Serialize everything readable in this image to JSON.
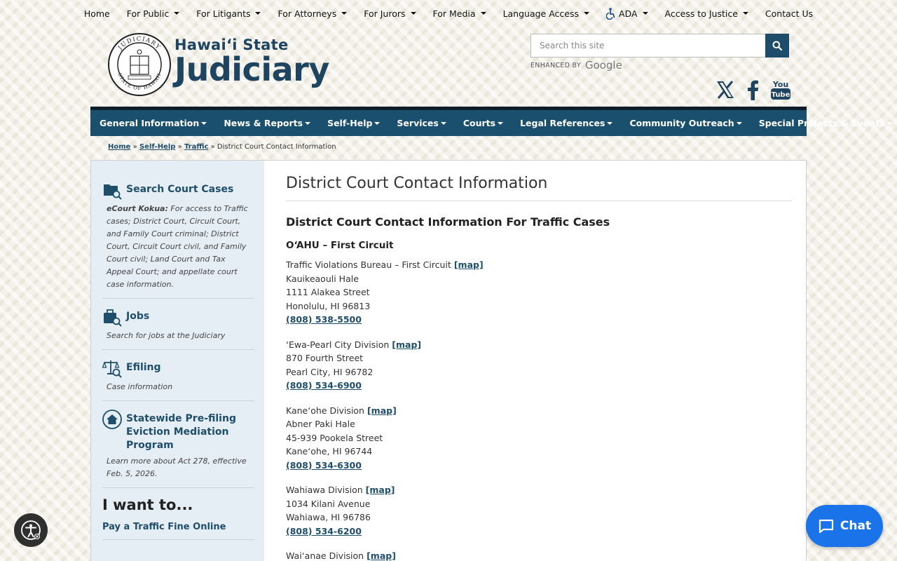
{
  "top_nav": [
    {
      "label": "Home",
      "dropdown": false
    },
    {
      "label": "For Public",
      "dropdown": true
    },
    {
      "label": "For Litigants",
      "dropdown": true
    },
    {
      "label": "For Attorneys",
      "dropdown": true
    },
    {
      "label": "For Jurors",
      "dropdown": true
    },
    {
      "label": "For Media",
      "dropdown": true
    },
    {
      "label": "Language Access",
      "dropdown": true
    },
    {
      "label": "ADA",
      "dropdown": true,
      "icon": "wheelchair-icon"
    },
    {
      "label": "Access to Justice",
      "dropdown": true
    },
    {
      "label": "Contact Us",
      "dropdown": false
    }
  ],
  "brand": {
    "line1": "Hawaiʻi State",
    "line2": "Judiciary",
    "seal_top": "JUDICIARY",
    "seal_bottom": "STATE OF HAWAII"
  },
  "search": {
    "placeholder": "Search this site",
    "enhanced_label": "ENHANCED BY",
    "provider": "Google"
  },
  "main_nav": [
    "General Information",
    "News & Reports",
    "Self-Help",
    "Services",
    "Courts",
    "Legal References",
    "Community Outreach",
    "Special Projects & Events"
  ],
  "breadcrumb": {
    "links": [
      "Home",
      "Self-Help",
      "Traffic"
    ],
    "current": "District Court Contact Information",
    "separator": "»"
  },
  "sidebar": {
    "items": [
      {
        "icon": "folder-search-icon",
        "label": "Search Court Cases",
        "desc_bold": "eCourt Kokua:",
        "desc": " For access to Traffic cases; District Court, Circuit Court, and Family Court criminal; District Court, Circuit Court civil, and Family Court civil; Land Court and Tax Appeal Court; and appellate court case information."
      },
      {
        "icon": "briefcase-search-icon",
        "label": "Jobs",
        "desc_bold": "",
        "desc": "Search for jobs at the Judiciary"
      },
      {
        "icon": "scales-search-icon",
        "label": "Efiling",
        "desc_bold": "",
        "desc": "Case information"
      },
      {
        "icon": "house-icon",
        "label": "Statewide Pre-filing Eviction Mediation Program",
        "desc_bold": "",
        "desc": "Learn more about Act 278, effective Feb. 5, 2026."
      }
    ],
    "iwant_title": "I want to...",
    "iwant_links": [
      "Pay a Traffic Fine Online"
    ]
  },
  "content": {
    "title": "District Court Contact Information",
    "subtitle": "District Court Contact Information For Traffic Cases",
    "circuit": "O‘AHU – First Circuit",
    "map_label": "[map]",
    "locations": [
      {
        "name": "Traffic Violations Bureau – First Circuit",
        "lines": [
          "Kauikeaouli Hale",
          "1111 Alakea Street",
          "Honolulu, HI 96813"
        ],
        "phone": "(808) 538-5500"
      },
      {
        "name": "ʻEwa-Pearl City Division",
        "lines": [
          "870 Fourth Street",
          "Pearl City, HI 96782"
        ],
        "phone": "(808) 534-6900"
      },
      {
        "name": "Kaneʻohe Division",
        "lines": [
          "Abner Paki Hale",
          "45-939 Pookela Street",
          "Kaneʻohe, HI 96744"
        ],
        "phone": "(808) 534-6300"
      },
      {
        "name": "Wahiawa Division",
        "lines": [
          "1034 Kilani Avenue",
          "Wahiawa, HI 96786"
        ],
        "phone": "(808) 534-6200"
      },
      {
        "name": "Waiʻanae Division",
        "lines": [],
        "phone": ""
      }
    ]
  },
  "chat": {
    "label": "Chat"
  },
  "colors": {
    "nav_blue": "#1a4f6d",
    "link_blue": "#1f4e6b",
    "chat_blue": "#1a73e8",
    "sidebar_bg": "#e6eef5"
  }
}
